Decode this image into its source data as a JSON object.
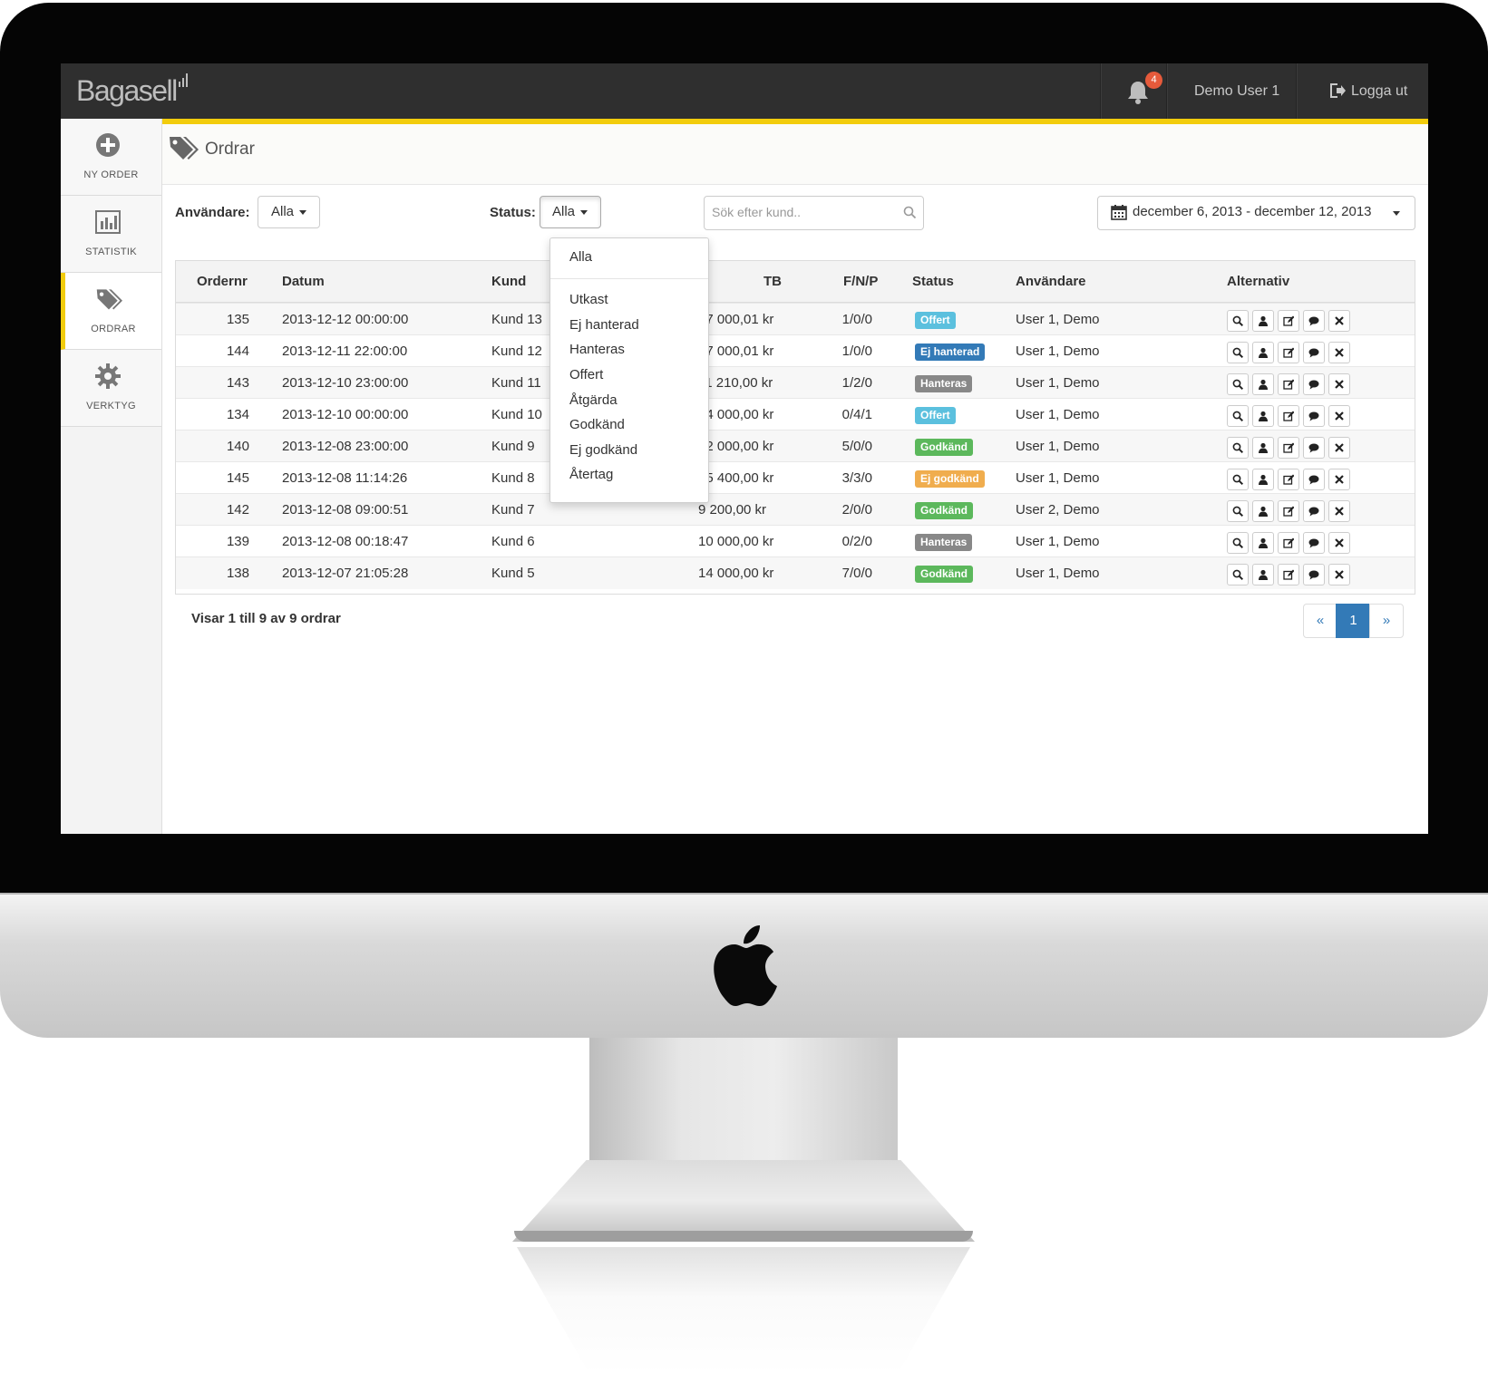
{
  "app": {
    "logo_text": "Bagasell"
  },
  "topbar": {
    "notification_count": "4",
    "user_name": "Demo User 1",
    "logout_label": "Logga ut"
  },
  "sidebar": {
    "items": [
      {
        "label": "NY ORDER",
        "icon": "plus-circle-icon"
      },
      {
        "label": "STATISTIK",
        "icon": "bar-chart-icon"
      },
      {
        "label": "ORDRAR",
        "icon": "tags-icon",
        "active": true
      },
      {
        "label": "VERKTYG",
        "icon": "gear-icon"
      }
    ]
  },
  "page": {
    "title": "Ordrar"
  },
  "filters": {
    "user_label": "Användare:",
    "user_value": "Alla",
    "status_label": "Status:",
    "status_value": "Alla",
    "search_placeholder": "Sök efter kund..",
    "date_range": "december 6, 2013 - december 12, 2013"
  },
  "status_dropdown": {
    "options": [
      "Alla",
      "Utkast",
      "Ej hanterad",
      "Hanteras",
      "Offert",
      "Åtgärda",
      "Godkänd",
      "Ej godkänd",
      "Återtag"
    ]
  },
  "table": {
    "headers": {
      "ordernr": "Ordernr",
      "datum": "Datum",
      "kund": "Kund",
      "tb": "TB",
      "fnp": "F/N/P",
      "status": "Status",
      "anvandare": "Användare",
      "alternativ": "Alternativ"
    },
    "rows": [
      {
        "ordernr": "135",
        "datum": "2013-12-12 00:00:00",
        "kund": "Kund 13",
        "tb": "17 000,01 kr",
        "fnp": "1/0/0",
        "status": "Offert",
        "status_color": "#5bc0de",
        "anvandare": "User 1, Demo"
      },
      {
        "ordernr": "144",
        "datum": "2013-12-11 22:00:00",
        "kund": "Kund 12",
        "tb": "27 000,01 kr",
        "fnp": "1/0/0",
        "status": "Ej hanterad",
        "status_color": "#337ab7",
        "anvandare": "User 1, Demo"
      },
      {
        "ordernr": "143",
        "datum": "2013-12-10 23:00:00",
        "kund": "Kund 11",
        "tb": "11 210,00 kr",
        "fnp": "1/2/0",
        "status": "Hanteras",
        "status_color": "#888888",
        "anvandare": "User 1, Demo"
      },
      {
        "ordernr": "134",
        "datum": "2013-12-10 00:00:00",
        "kund": "Kund 10",
        "tb": "14 000,00 kr",
        "fnp": "0/4/1",
        "status": "Offert",
        "status_color": "#5bc0de",
        "anvandare": "User 1, Demo"
      },
      {
        "ordernr": "140",
        "datum": "2013-12-08 23:00:00",
        "kund": "Kund 9",
        "tb": "12 000,00 kr",
        "fnp": "5/0/0",
        "status": "Godkänd",
        "status_color": "#5cb85c",
        "anvandare": "User 1, Demo"
      },
      {
        "ordernr": "145",
        "datum": "2013-12-08 11:14:26",
        "kund": "Kund 8",
        "tb": "15 400,00 kr",
        "fnp": "3/3/0",
        "status": "Ej godkänd",
        "status_color": "#f0ad4e",
        "anvandare": "User 1, Demo"
      },
      {
        "ordernr": "142",
        "datum": "2013-12-08 09:00:51",
        "kund": "Kund 7",
        "tb": "9 200,00 kr",
        "fnp": "2/0/0",
        "status": "Godkänd",
        "status_color": "#5cb85c",
        "anvandare": "User 2, Demo"
      },
      {
        "ordernr": "139",
        "datum": "2013-12-08 00:18:47",
        "kund": "Kund 6",
        "tb": "10 000,00 kr",
        "fnp": "0/2/0",
        "status": "Hanteras",
        "status_color": "#888888",
        "anvandare": "User 1, Demo"
      },
      {
        "ordernr": "138",
        "datum": "2013-12-07 21:05:28",
        "kund": "Kund 5",
        "tb": "14 000,00 kr",
        "fnp": "7/0/0",
        "status": "Godkänd",
        "status_color": "#5cb85c",
        "anvandare": "User 1, Demo"
      }
    ],
    "action_icons": [
      "zoom-icon",
      "user-icon",
      "edit-icon",
      "comment-icon",
      "remove-icon"
    ]
  },
  "footer": {
    "summary": "Visar 1 till 9 av 9 ordrar"
  },
  "pagination": {
    "prev": "«",
    "current": "1",
    "next": "»"
  },
  "colors": {
    "accent": "#f2cc0c",
    "topbar": "#2f2f2f",
    "primary": "#337ab7",
    "notification": "#e65a3b"
  }
}
